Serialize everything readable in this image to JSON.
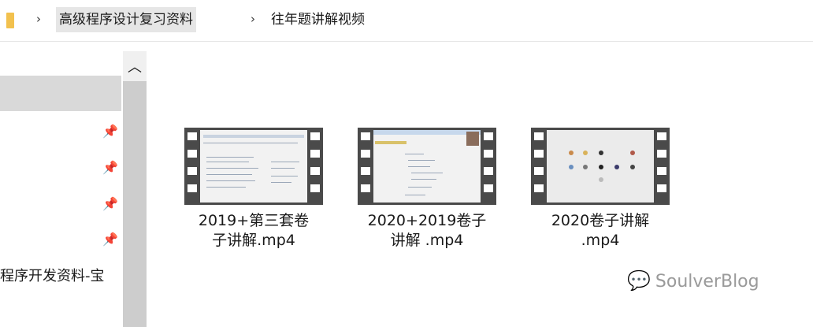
{
  "breadcrumb": {
    "items": [
      "高级程序设计复习资料",
      "往年题讲解视频"
    ]
  },
  "nav": {
    "pinned_count": 4,
    "partial_label": "程序开发资料-宝"
  },
  "files": [
    {
      "name": "2019+第三套卷子讲解.mp4",
      "line1": "2019+第三套卷",
      "line2": "子讲解.mp4"
    },
    {
      "name": "2020+2019卷子讲解 .mp4",
      "line1": "2020+2019卷子",
      "line2": "讲解 .mp4"
    },
    {
      "name": "2020卷子讲解.mp4",
      "line1": "2020卷子讲解",
      "line2": ".mp4"
    }
  ],
  "watermark": {
    "text": "SoulverBlog",
    "icon": "wechat-icon"
  }
}
